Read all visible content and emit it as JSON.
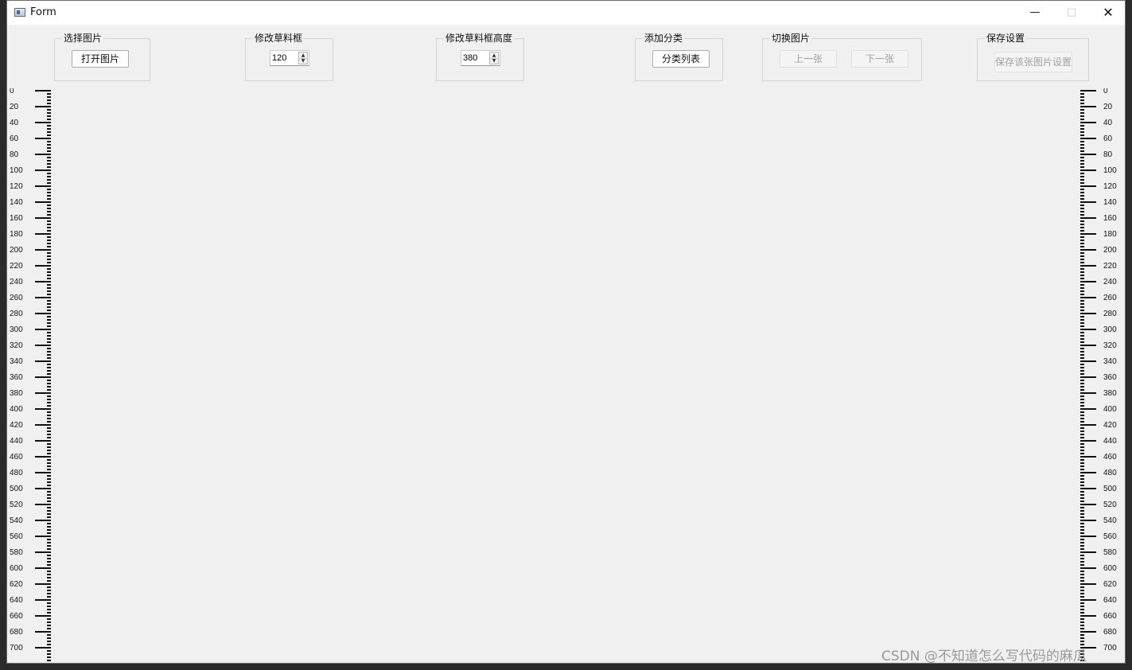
{
  "window": {
    "title": "Form",
    "controls": {
      "minimize": "—",
      "maximize": "□",
      "close": "✕"
    },
    "icon": "app-window-icon"
  },
  "groups": {
    "select_image": {
      "title": "选择图片",
      "open_button": "打开图片"
    },
    "modify_box": {
      "title": "修改草料框",
      "value": "120"
    },
    "modify_box_height": {
      "title": "修改草料框高度",
      "value": "380"
    },
    "add_category": {
      "title": "添加分类",
      "list_button": "分类列表"
    },
    "switch_image": {
      "title": "切换图片",
      "prev_button": "上一张",
      "next_button": "下一张"
    },
    "save_settings": {
      "title": "保存设置",
      "save_button": "保存该张图片设置"
    }
  },
  "rulers": {
    "labels": [
      "0",
      "20",
      "40",
      "60",
      "80",
      "100",
      "120",
      "140",
      "160",
      "180",
      "200",
      "220",
      "240",
      "260",
      "280",
      "300",
      "320",
      "340",
      "360",
      "380",
      "400",
      "420",
      "440",
      "460",
      "480",
      "500",
      "520",
      "540",
      "560",
      "580",
      "600",
      "620",
      "640",
      "660",
      "680",
      "700"
    ]
  },
  "watermark": "CSDN @不知道怎么写代码的麻瓜",
  "colors": {
    "window_bg": "#f0f0f0",
    "titlebar": "#ffffff",
    "disabled_text": "#a0a0a0"
  }
}
